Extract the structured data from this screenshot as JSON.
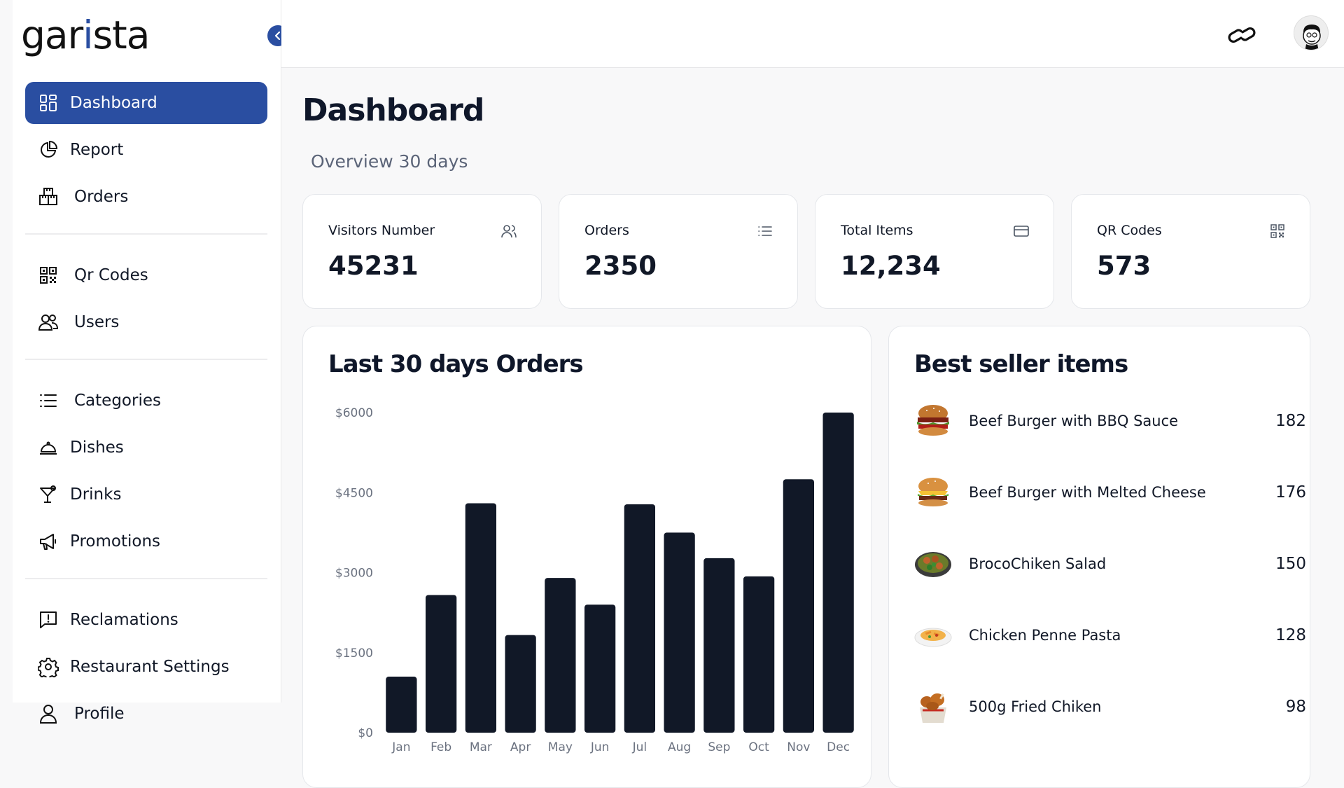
{
  "app": {
    "brand_prefix": "gar",
    "brand_accent": "i",
    "brand_suffix": "sta",
    "accent_color": "#2a4ea1"
  },
  "sidebar": {
    "items": [
      {
        "label": "Dashboard",
        "icon": "grid-icon",
        "active": true
      },
      {
        "label": "Report",
        "icon": "pie-chart-icon"
      },
      {
        "label": "Orders",
        "icon": "boxes-icon"
      },
      {
        "label": "Qr Codes",
        "icon": "qr-code-icon"
      },
      {
        "label": "Users",
        "icon": "users-icon"
      },
      {
        "label": "Categories",
        "icon": "list-icon"
      },
      {
        "label": "Dishes",
        "icon": "cloche-icon"
      },
      {
        "label": "Drinks",
        "icon": "cocktail-icon"
      },
      {
        "label": "Promotions",
        "icon": "megaphone-icon"
      },
      {
        "label": "Reclamations",
        "icon": "message-alert-icon"
      },
      {
        "label": "Restaurant Settings",
        "icon": "gear-icon"
      },
      {
        "label": "Profile",
        "icon": "user-icon"
      }
    ]
  },
  "header": {
    "title": "Dashboard",
    "subtitle": "Overview 30 days"
  },
  "stats": [
    {
      "label": "Visitors Number",
      "value": "45231",
      "icon": "users-icon"
    },
    {
      "label": "Orders",
      "value": "2350",
      "icon": "list-icon"
    },
    {
      "label": "Total Items",
      "value": "12,234",
      "icon": "credit-card-icon"
    },
    {
      "label": "QR Codes",
      "value": "573",
      "icon": "qr-code-icon"
    }
  ],
  "orders_panel": {
    "title": "Last 30 days Orders"
  },
  "chart_data": {
    "type": "bar",
    "title": "Last 30 days Orders",
    "categories": [
      "Jan",
      "Feb",
      "Mar",
      "Apr",
      "May",
      "Jun",
      "Jul",
      "Aug",
      "Sep",
      "Oct",
      "Nov",
      "Dec"
    ],
    "values": [
      1050,
      2580,
      4300,
      1830,
      2900,
      2400,
      4280,
      3750,
      3270,
      2930,
      4750,
      6000
    ],
    "y_ticks": [
      "$0",
      "$1500",
      "$3000",
      "$4500",
      "$6000"
    ],
    "ylim": [
      0,
      6000
    ],
    "bar_color": "#111827",
    "grid": false
  },
  "best_seller": {
    "title": "Best seller items",
    "items": [
      {
        "name": "Beef Burger with BBQ Sauce",
        "count": "182"
      },
      {
        "name": "Beef Burger with Melted Cheese",
        "count": "176"
      },
      {
        "name": "BrocoChiken Salad",
        "count": "150"
      },
      {
        "name": "Chicken Penne Pasta",
        "count": "128"
      },
      {
        "name": "500g Fried Chiken",
        "count": "98"
      }
    ]
  }
}
